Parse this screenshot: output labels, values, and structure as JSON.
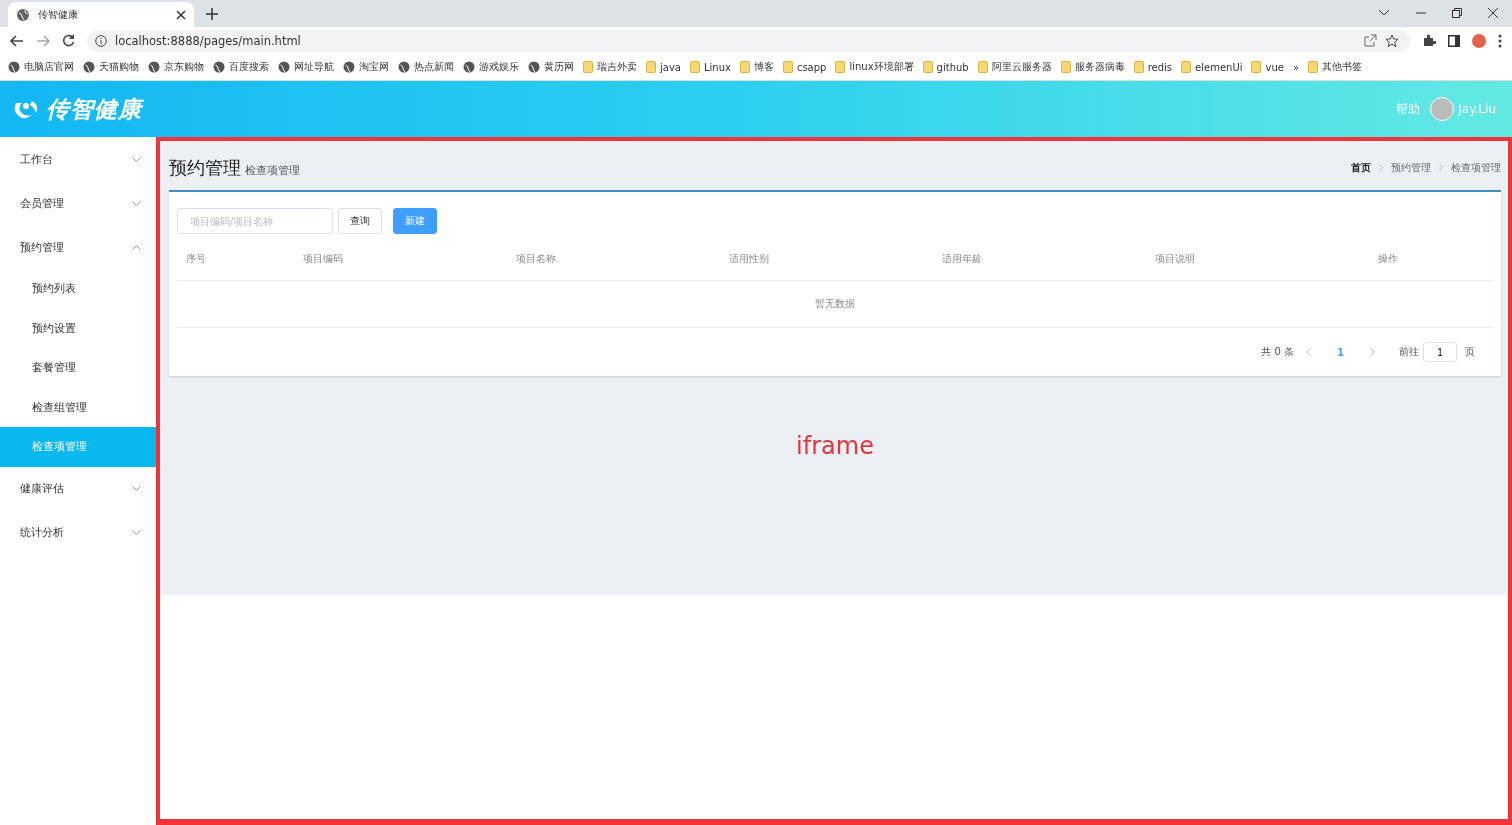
{
  "browser": {
    "tab_title": "传智健康",
    "url": "localhost:8888/pages/main.html",
    "bookmarks": [
      {
        "label": "电脑店官网",
        "kind": "site"
      },
      {
        "label": "天猫购物",
        "kind": "site"
      },
      {
        "label": "京东购物",
        "kind": "site"
      },
      {
        "label": "百度搜索",
        "kind": "site"
      },
      {
        "label": "网址导航",
        "kind": "site"
      },
      {
        "label": "淘宝网",
        "kind": "site"
      },
      {
        "label": "热点新闻",
        "kind": "site"
      },
      {
        "label": "游戏娱乐",
        "kind": "site"
      },
      {
        "label": "黄历网",
        "kind": "site"
      },
      {
        "label": "瑞吉外卖",
        "kind": "folder"
      },
      {
        "label": "java",
        "kind": "folder"
      },
      {
        "label": "Linux",
        "kind": "folder"
      },
      {
        "label": "博客",
        "kind": "folder"
      },
      {
        "label": "csapp",
        "kind": "folder"
      },
      {
        "label": "linux环境部署",
        "kind": "folder"
      },
      {
        "label": "github",
        "kind": "folder"
      },
      {
        "label": "阿里云服务器",
        "kind": "folder"
      },
      {
        "label": "服务器病毒",
        "kind": "folder"
      },
      {
        "label": "redis",
        "kind": "folder"
      },
      {
        "label": "elemenUi",
        "kind": "folder"
      },
      {
        "label": "vue",
        "kind": "folder"
      }
    ],
    "more": "»",
    "other_bookmarks": "其他书签"
  },
  "header": {
    "logo": "传智健康",
    "help": "帮助",
    "user": "Jay.Liu"
  },
  "sidebar": {
    "items": [
      {
        "label": "工作台",
        "expanded": false
      },
      {
        "label": "会员管理",
        "expanded": false
      },
      {
        "label": "预约管理",
        "expanded": true,
        "children": [
          {
            "label": "预约列表",
            "selected": false
          },
          {
            "label": "预约设置",
            "selected": false
          },
          {
            "label": "套餐管理",
            "selected": false
          },
          {
            "label": "检查组管理",
            "selected": false
          },
          {
            "label": "检查项管理",
            "selected": true
          }
        ]
      },
      {
        "label": "健康评估",
        "expanded": false
      },
      {
        "label": "统计分析",
        "expanded": false
      }
    ]
  },
  "page": {
    "title": "预约管理",
    "subtitle": "检查项管理",
    "breadcrumb": [
      "首页",
      "预约管理",
      "检查项管理"
    ],
    "search": {
      "placeholder": "项目编码/项目名称"
    },
    "query_button": "查询",
    "new_button": "新建",
    "table": {
      "columns": [
        "序号",
        "项目编码",
        "项目名称",
        "适用性别",
        "适用年龄",
        "项目说明",
        "操作"
      ],
      "empty_text": "暂无数据"
    },
    "pagination": {
      "total": "共 0 条",
      "pages": [
        {
          "label": "1",
          "selected": true
        }
      ],
      "goto_label": "前往",
      "goto_value": "1",
      "goto_suffix": "页"
    }
  },
  "annotation": "iframe"
}
